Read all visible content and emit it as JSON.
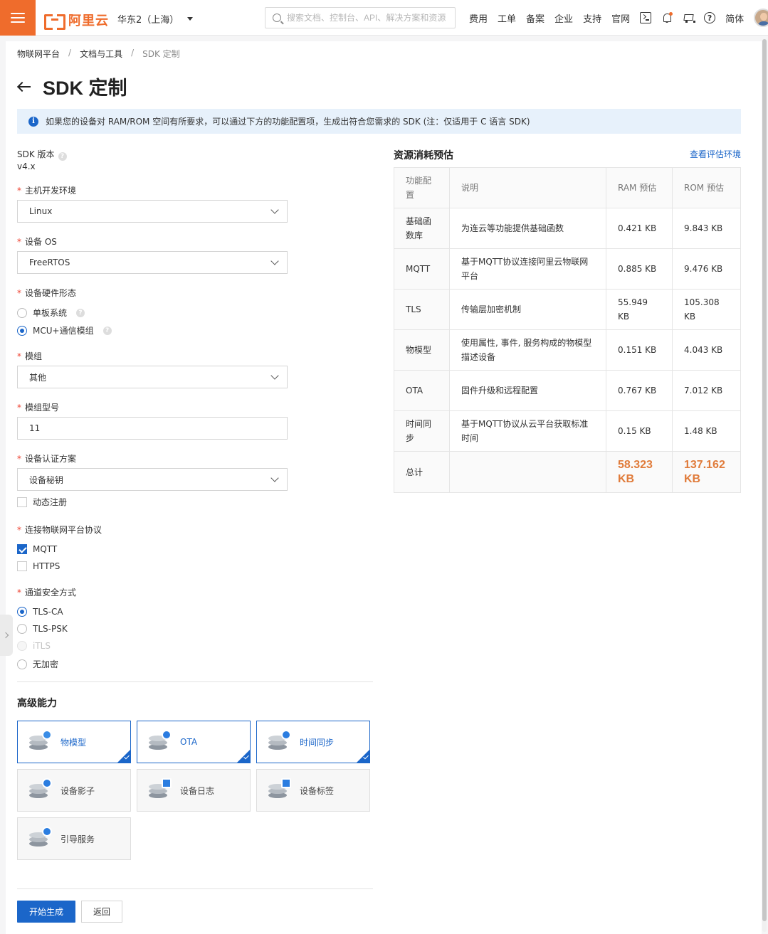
{
  "topbar": {
    "logo_text": "阿里云",
    "region": "华东2（上海）",
    "search_placeholder": "搜索文档、控制台、API、解决方案和资源",
    "nav": [
      "费用",
      "工单",
      "备案",
      "企业",
      "支持",
      "官网"
    ],
    "help_glyph": "?",
    "lang": "简体"
  },
  "breadcrumb": {
    "items": [
      "物联网平台",
      "文档与工具",
      "SDK 定制"
    ],
    "sep": "/"
  },
  "page": {
    "title": "SDK 定制",
    "notice": "如果您的设备对 RAM/ROM 空间有所要求，可以通过下方的功能配置项，生成出符合您需求的 SDK (注：仅适用于 C 语言 SDK)"
  },
  "form": {
    "sdk_version_label": "SDK 版本",
    "sdk_version": "v4.x",
    "required_mark": "*",
    "help_glyph": "?",
    "host_env_label": "主机开发环境",
    "host_env": "Linux",
    "device_os_label": "设备 OS",
    "device_os": "FreeRTOS",
    "hw_form_label": "设备硬件形态",
    "hw_form_options": [
      "单板系统",
      "MCU+通信模组"
    ],
    "hw_form_selected": "MCU+通信模组",
    "module_label": "模组",
    "module": "其他",
    "module_model_label": "模组型号",
    "module_model": "11",
    "auth_label": "设备认证方案",
    "auth": "设备秘钥",
    "dynamic_reg_label": "动态注册",
    "dynamic_reg_checked": false,
    "protocol_label": "连接物联网平台协议",
    "protocols": [
      {
        "label": "MQTT",
        "checked": true
      },
      {
        "label": "HTTPS",
        "checked": false
      }
    ],
    "security_label": "通道安全方式",
    "security_options": [
      {
        "label": "TLS-CA",
        "selected": true,
        "disabled": false
      },
      {
        "label": "TLS-PSK",
        "selected": false,
        "disabled": false
      },
      {
        "label": "iTLS",
        "selected": false,
        "disabled": true
      },
      {
        "label": "无加密",
        "selected": false,
        "disabled": false
      }
    ]
  },
  "advanced": {
    "title": "高级能力",
    "items": [
      {
        "label": "物模型",
        "selected": true,
        "icon": "thing-model-icon"
      },
      {
        "label": "OTA",
        "selected": true,
        "icon": "ota-icon"
      },
      {
        "label": "时间同步",
        "selected": true,
        "icon": "time-sync-icon"
      },
      {
        "label": "设备影子",
        "selected": false,
        "icon": "device-shadow-icon"
      },
      {
        "label": "设备日志",
        "selected": false,
        "icon": "device-log-icon"
      },
      {
        "label": "设备标签",
        "selected": false,
        "icon": "device-tag-icon"
      },
      {
        "label": "引导服务",
        "selected": false,
        "icon": "bootstrap-service-icon"
      }
    ]
  },
  "actions": {
    "generate": "开始生成",
    "back": "返回"
  },
  "resources": {
    "title": "资源消耗预估",
    "link": "查看评估环境",
    "headers": [
      "功能配置",
      "说明",
      "RAM 预估",
      "ROM 预估"
    ],
    "rows": [
      {
        "feature": "基础函数库",
        "desc": "为连云等功能提供基础函数",
        "ram": "0.421 KB",
        "rom": "9.843 KB"
      },
      {
        "feature": "MQTT",
        "desc": "基于MQTT协议连接阿里云物联网平台",
        "ram": "0.885 KB",
        "rom": "9.476 KB"
      },
      {
        "feature": "TLS",
        "desc": "传输层加密机制",
        "ram": "55.949 KB",
        "rom": "105.308 KB"
      },
      {
        "feature": "物模型",
        "desc": "使用属性, 事件, 服务构成的物模型描述设备",
        "ram": "0.151 KB",
        "rom": "4.043 KB"
      },
      {
        "feature": "OTA",
        "desc": "固件升级和远程配置",
        "ram": "0.767 KB",
        "rom": "7.012 KB"
      },
      {
        "feature": "时间同步",
        "desc": "基于MQTT协议从云平台获取标准时间",
        "ram": "0.15 KB",
        "rom": "1.48 KB"
      }
    ],
    "total": {
      "feature": "总计",
      "ram": "58.323 KB",
      "rom": "137.162 KB"
    },
    "total_color": "#e07b3a"
  },
  "colors": {
    "brand": "#ef6c2c",
    "primary": "#1b66c9"
  }
}
